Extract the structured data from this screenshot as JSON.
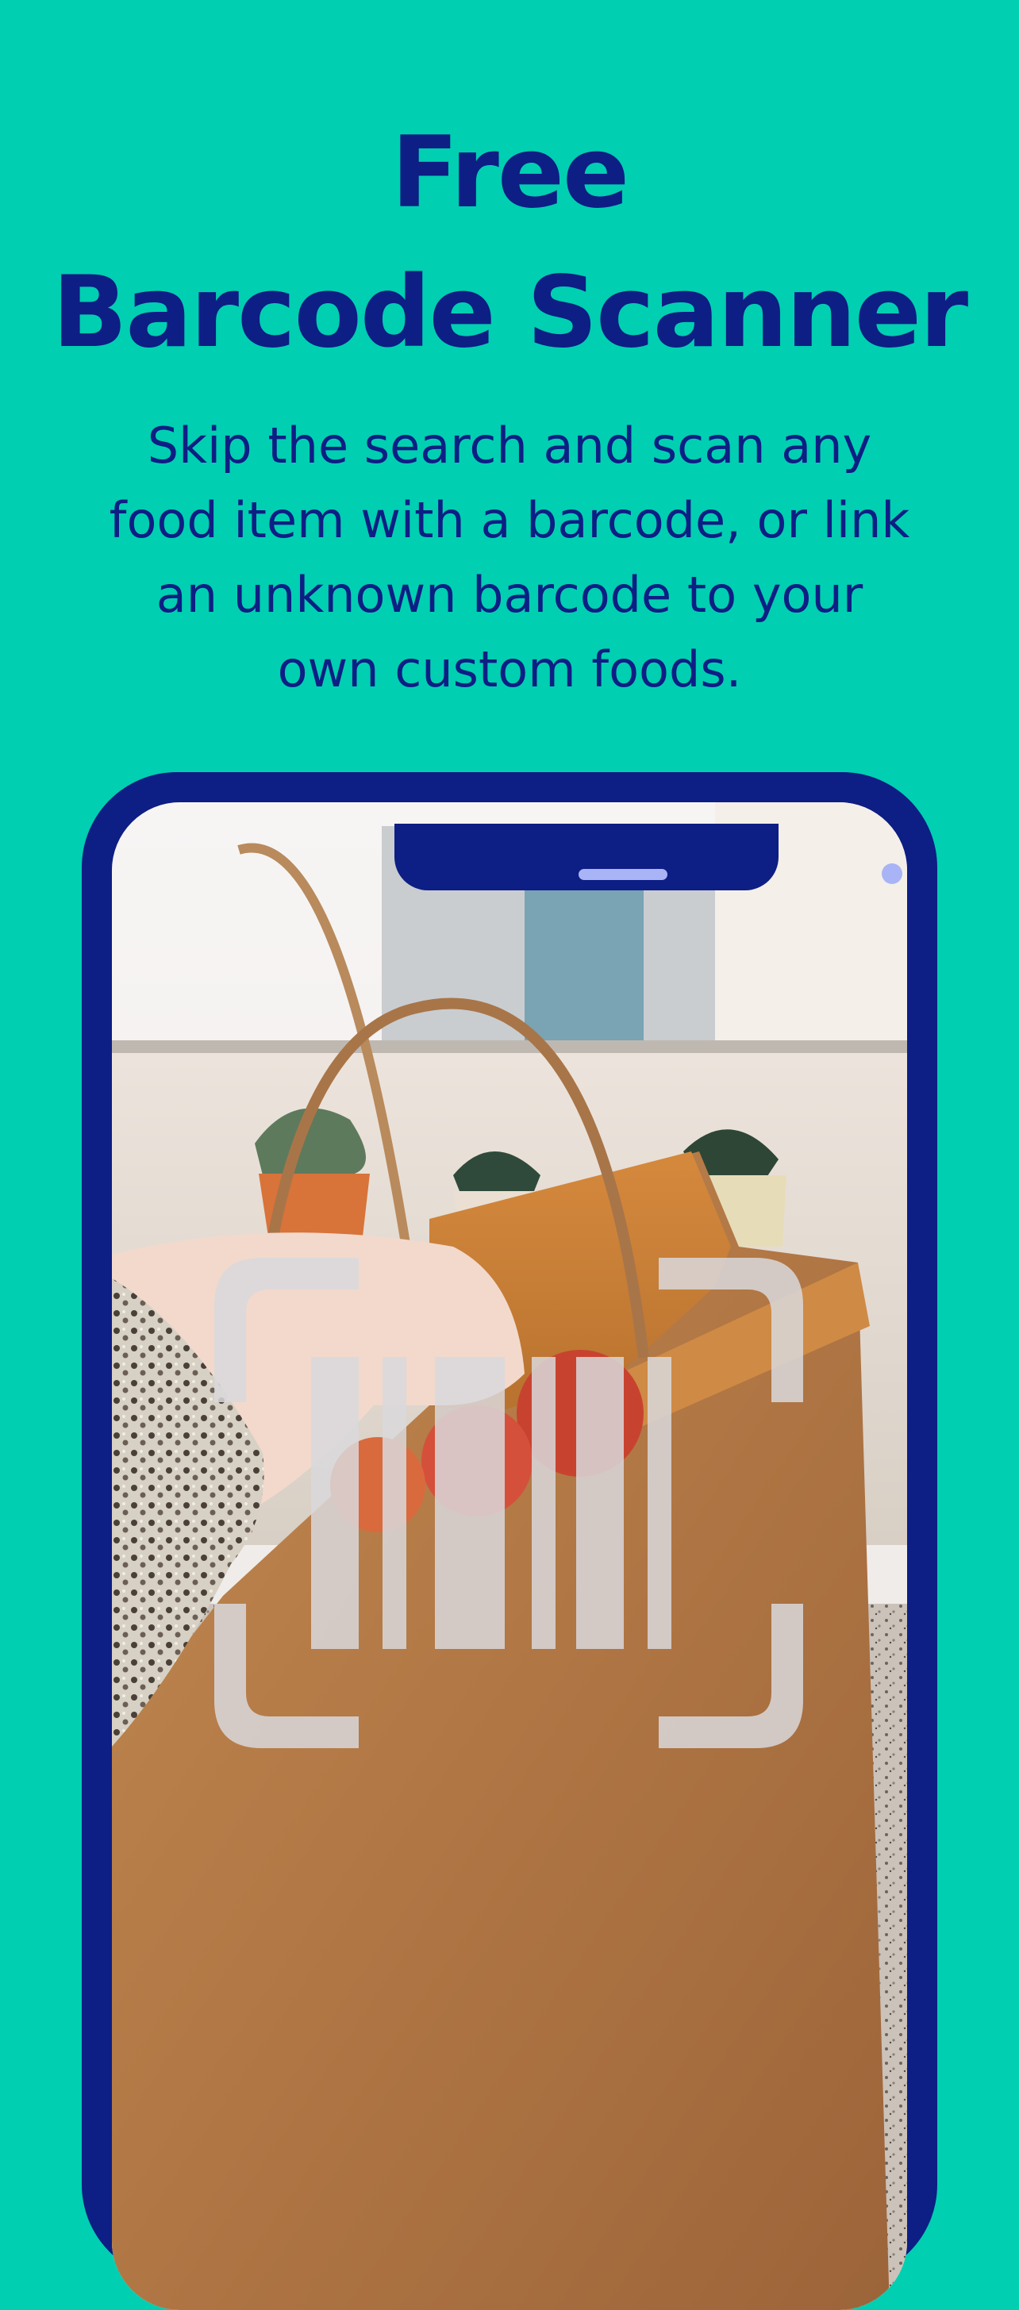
{
  "header": {
    "title_line1": "Free",
    "title_line2": "Barcode Scanner"
  },
  "subtitle": {
    "line1": "Skip the search and scan any",
    "line2": "food item with a barcode, or link",
    "line3": "an unknown barcode to your",
    "line4": "own custom foods."
  },
  "colors": {
    "background": "#00CFB2",
    "brand_navy": "#0D1E84",
    "accent_lavender": "#A9B4F6"
  },
  "icons": {
    "scanner": "barcode-scan-icon"
  }
}
